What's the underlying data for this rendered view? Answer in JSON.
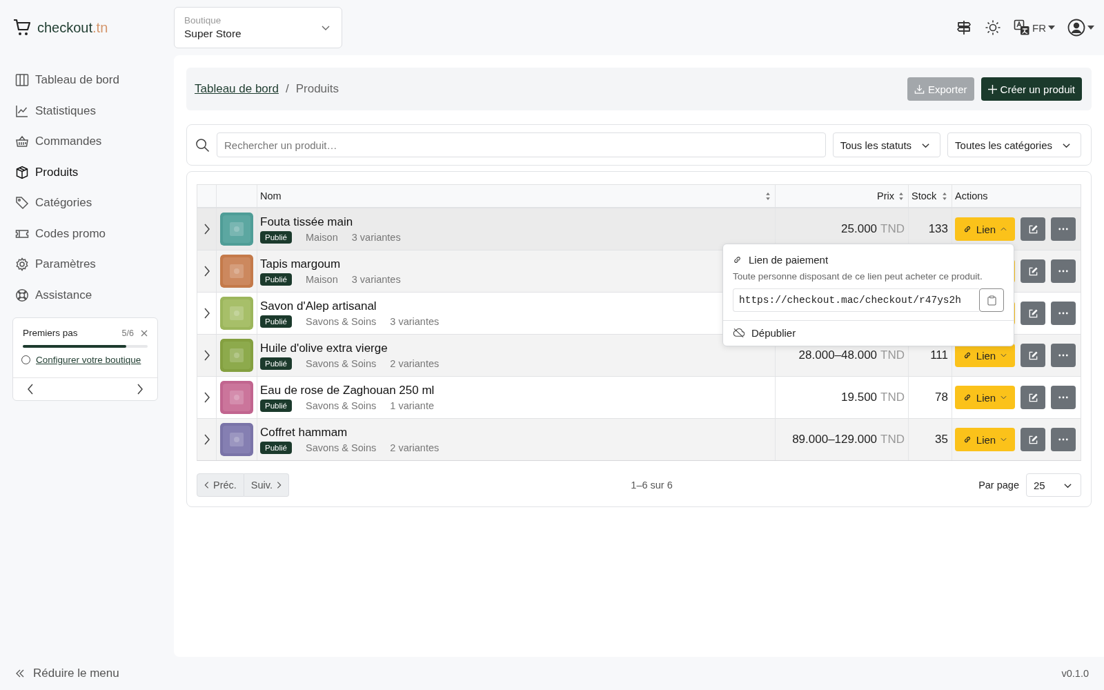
{
  "brand": {
    "name": "checkout",
    "suffix": ".tn"
  },
  "store_select": {
    "label": "Boutique",
    "value": "Super Store"
  },
  "header": {
    "language": "FR"
  },
  "sidebar": {
    "items": [
      {
        "label": "Tableau de bord",
        "selected": false
      },
      {
        "label": "Statistiques",
        "selected": false
      },
      {
        "label": "Commandes",
        "selected": false
      },
      {
        "label": "Produits",
        "selected": true
      },
      {
        "label": "Catégories",
        "selected": false
      },
      {
        "label": "Codes promo",
        "selected": false
      },
      {
        "label": "Paramètres",
        "selected": false
      },
      {
        "label": "Assistance",
        "selected": false
      }
    ]
  },
  "onboarding": {
    "title": "Premiers pas",
    "count": "5/6",
    "level": 0.83,
    "task": {
      "label": "Configurer votre boutique",
      "checked": false
    }
  },
  "breadcrumb_separator": "/",
  "breadcrumb": [
    {
      "label": "Tableau de bord",
      "kind": "link"
    },
    {
      "label": "Produits",
      "kind": "current"
    }
  ],
  "actions": [
    {
      "label": "Exporter",
      "kind": "secondary"
    },
    {
      "label": "Créer un produit",
      "kind": "primary"
    }
  ],
  "filters": {
    "search_placeholder": "Rechercher un produit…",
    "status": "Tous les statuts",
    "category": "Toutes les catégories"
  },
  "table": {
    "columns": [
      {
        "label": "Nom",
        "sortable": true
      },
      {
        "label": "Prix",
        "sortable": true
      },
      {
        "label": "Stock",
        "sortable": true
      },
      {
        "label": "Actions",
        "sortable": false
      }
    ],
    "rows": [
      {
        "name": "Fouta tissée main",
        "status": "Publié",
        "category": "Maison",
        "variants": "3 variantes",
        "price": "25.000",
        "currency": "TND",
        "stock": "133",
        "link_label": "Lien",
        "link_open": true
      },
      {
        "name": "Tapis margoum",
        "status": "Publié",
        "category": "Maison",
        "variants": "3 variantes"
      },
      {
        "name": "Savon d'Alep artisanal",
        "status": "Publié",
        "category": "Savons & Soins",
        "variants": "3 variantes"
      },
      {
        "name": "Huile d'olive extra vierge",
        "status": "Publié",
        "category": "Savons & Soins",
        "variants": "2 variantes",
        "price": "28.000–48.000",
        "currency": "TND",
        "stock": "111",
        "link_label": "Lien",
        "link_open": false
      },
      {
        "name": "Eau de rose de Zaghouan 250 ml",
        "status": "Publié",
        "category": "Savons & Soins",
        "variants": "1 variante",
        "price": "19.500",
        "currency": "TND",
        "stock": "78",
        "link_label": "Lien",
        "link_open": false
      },
      {
        "name": "Coffret hammam",
        "status": "Publié",
        "category": "Savons & Soins",
        "variants": "2 variantes",
        "price": "89.000–129.000",
        "currency": "TND",
        "stock": "35",
        "link_label": "Lien",
        "link_open": false
      }
    ]
  },
  "popover": {
    "title": "Lien de paiement",
    "description": "Toute personne disposant de ce lien peut acheter ce produit.",
    "url": "https://checkout.mac/checkout/r47ys2h",
    "action": "Dépublier"
  },
  "pagination": {
    "prev": "Préc.",
    "next": "Suiv.",
    "summary": "1–6 sur 6",
    "per_page_label": "Par page",
    "per_page": "25"
  },
  "footer": {
    "collapse": "Réduire le menu",
    "version": "v0.1.0"
  }
}
